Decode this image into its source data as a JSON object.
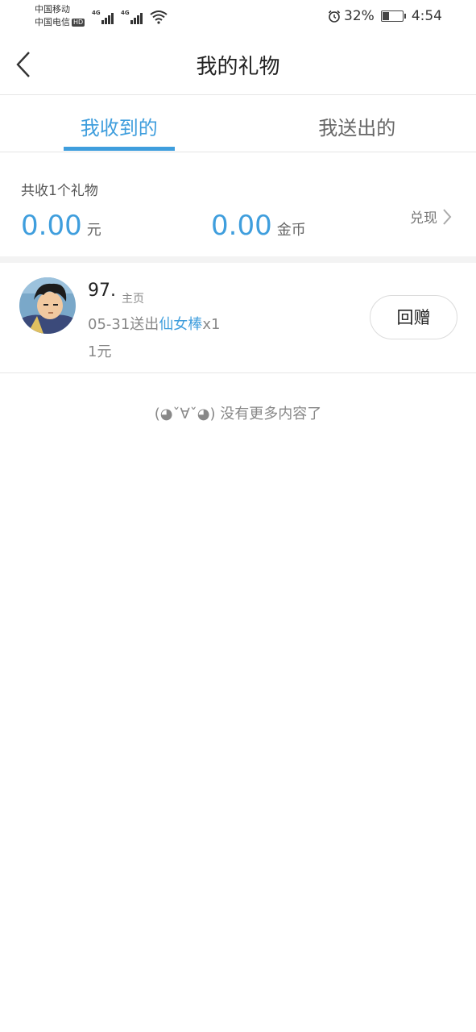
{
  "status_bar": {
    "carrier_1": "中国移动",
    "carrier_2": "中国电信",
    "hd_badge": "HD",
    "network_1": "4G",
    "network_2": "4G",
    "battery_percent": "32%",
    "time": "4:54"
  },
  "header": {
    "title": "我的礼物"
  },
  "tabs": [
    {
      "label": "我收到的",
      "active": true
    },
    {
      "label": "我送出的",
      "active": false
    }
  ],
  "summary": {
    "count_text": "共收1个礼物",
    "money_value": "0.00",
    "money_unit": "元",
    "coin_value": "0.00",
    "coin_unit": "金币",
    "withdraw_label": "兑现"
  },
  "gifts": [
    {
      "user_name": "97.",
      "home_label": "主页",
      "date_sent": "05-31送出",
      "gift_name": "仙女棒",
      "quantity": "x1",
      "price": "1元",
      "reply_label": "回赠"
    }
  ],
  "footer": {
    "no_more_text": "(◕ˇ∀ˇ◕) 没有更多内容了"
  },
  "colors": {
    "accent": "#3f9edd",
    "divider": "#e5e5e5"
  }
}
